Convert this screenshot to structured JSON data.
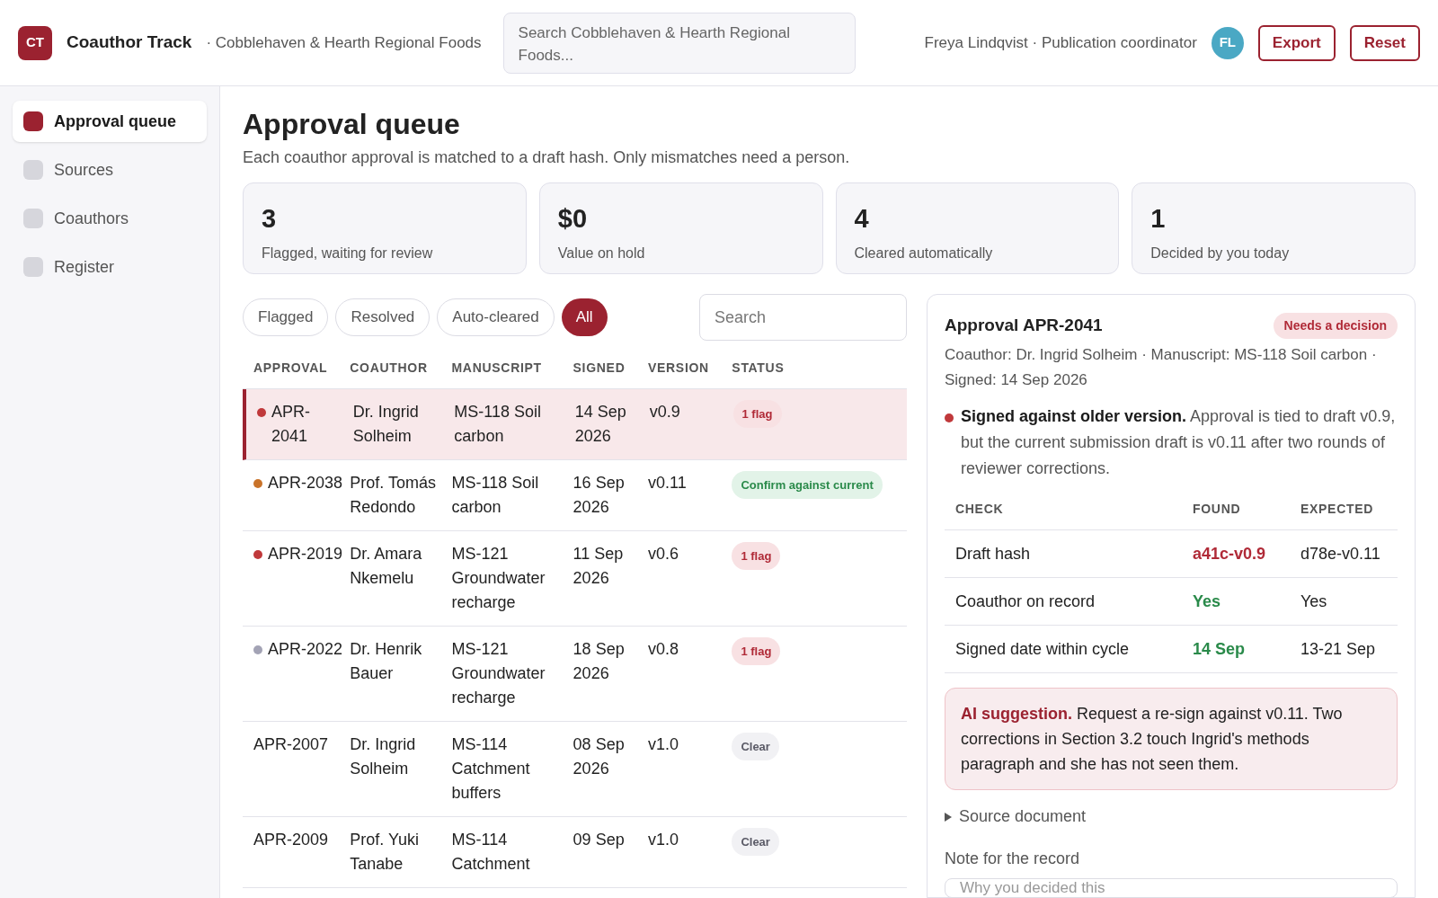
{
  "header": {
    "logo": "CT",
    "app_name": "Coauthor Track",
    "org": "· Cobblehaven & Hearth Regional Foods",
    "search": {
      "placeholder": "Search Cobblehaven & Hearth Regional Foods..."
    },
    "user": "Freya Lindqvist · Publication coordinator",
    "avatar": "FL",
    "buttons": [
      "Export",
      "Reset"
    ]
  },
  "sidebar": {
    "items": [
      {
        "label": "Approval queue",
        "selected": true
      },
      {
        "label": "Sources",
        "selected": false
      },
      {
        "label": "Coauthors",
        "selected": false
      },
      {
        "label": "Register",
        "selected": false
      }
    ]
  },
  "page": {
    "title": "Approval queue",
    "subtitle": "Each coauthor approval is matched to a draft hash. Only mismatches need a person."
  },
  "stats": [
    {
      "value": "3",
      "label": "Flagged, waiting for review"
    },
    {
      "value": "$0",
      "label": "Value on hold"
    },
    {
      "value": "4",
      "label": "Cleared automatically"
    },
    {
      "value": "1",
      "label": "Decided by you today"
    }
  ],
  "filters": [
    {
      "label": "Flagged",
      "selected": false
    },
    {
      "label": "Resolved",
      "selected": false
    },
    {
      "label": "Auto-cleared",
      "selected": false
    },
    {
      "label": "All",
      "selected": true
    }
  ],
  "table_search": {
    "placeholder": "Search"
  },
  "table": {
    "columns": [
      "APPROVAL",
      "COAUTHOR",
      "MANUSCRIPT",
      "SIGNED",
      "VERSION",
      "STATUS"
    ],
    "rows": [
      {
        "approval": "APR-2041",
        "coauthor": "Dr. Ingrid Solheim",
        "manuscript": "MS-118 Soil carbon",
        "signed": "14 Sep 2026",
        "version": "v0.9",
        "status": {
          "kind": "flag",
          "label": "1 flag"
        },
        "color": "#c0393b",
        "selected": true
      },
      {
        "approval": "APR-2038",
        "coauthor": "Prof. Tomás Redondo",
        "manuscript": "MS-118 Soil carbon",
        "signed": "16 Sep 2026",
        "version": "v0.11",
        "status": {
          "kind": "confirm",
          "label": "Confirm against current"
        },
        "color": "#c9732a",
        "selected": false
      },
      {
        "approval": "APR-2019",
        "coauthor": "Dr. Amara Nkemelu",
        "manuscript": "MS-121 Groundwater recharge",
        "signed": "11 Sep 2026",
        "version": "v0.6",
        "status": {
          "kind": "flag",
          "label": "1 flag"
        },
        "color": "#c0393b",
        "selected": false
      },
      {
        "approval": "APR-2022",
        "coauthor": "Dr. Henrik Bauer",
        "manuscript": "MS-121 Groundwater recharge",
        "signed": "18 Sep 2026",
        "version": "v0.8",
        "status": {
          "kind": "flag",
          "label": "1 flag"
        },
        "color": "#a3a3b5",
        "selected": false
      },
      {
        "approval": "APR-2007",
        "coauthor": "Dr. Ingrid Solheim",
        "manuscript": "MS-114 Catchment buffers",
        "signed": "08 Sep 2026",
        "version": "v1.0",
        "status": {
          "kind": "clear",
          "label": "Clear"
        },
        "selected": false
      },
      {
        "approval": "APR-2009",
        "coauthor": "Prof. Yuki Tanabe",
        "manuscript": "MS-114 Catchment",
        "signed": "09 Sep",
        "version": "v1.0",
        "status": {
          "kind": "clear",
          "label": "Clear"
        },
        "selected": false
      }
    ]
  },
  "detail": {
    "title": "Approval APR-2041",
    "badge": "Needs a decision",
    "meta": "Coauthor: Dr. Ingrid Solheim · Manuscript: MS-118 Soil carbon · Signed: 14 Sep 2026",
    "finding": "**Signed against older version.** Approval is tied to draft v0.9, but the current submission draft is v0.11 after two rounds of reviewer corrections.",
    "checks": {
      "columns": [
        "CHECK",
        "FOUND",
        "EXPECTED"
      ],
      "rows": [
        {
          "check": "Draft hash",
          "found": "a41c-v0.9",
          "passed": false,
          "expected": "d78e-v0.11"
        },
        {
          "check": "Coauthor on record",
          "found": "Yes",
          "passed": true,
          "expected": "Yes"
        },
        {
          "check": "Signed date within cycle",
          "found": "14 Sep",
          "passed": true,
          "expected": "13-21 Sep"
        }
      ]
    },
    "ai_suggestion": {
      "label": "AI suggestion.",
      "text": "Request a re-sign against v0.11. Two corrections in Section 3.2 touch Ingrid's methods paragraph and she has not seen them."
    },
    "source_document": {
      "label": "Source document",
      "expanded": false
    },
    "note": {
      "label": "Note for the record",
      "placeholder": "Why you decided this"
    }
  }
}
